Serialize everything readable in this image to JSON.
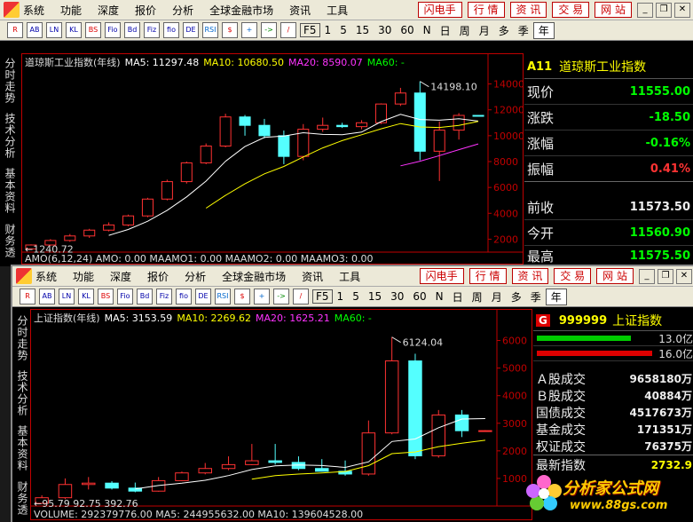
{
  "menu": {
    "items": [
      "系统",
      "功能",
      "深度",
      "报价",
      "分析",
      "全球金融市场",
      "资讯",
      "工具"
    ],
    "tabs": [
      "闪电手",
      "行  情",
      "资  讯",
      "交  易",
      "网  站"
    ]
  },
  "toolbar": {
    "icons": [
      "R",
      "AB",
      "LN",
      "KL",
      "BS",
      "Fio",
      "Bd",
      "Fiz",
      "fio",
      "DE",
      "RSI",
      "$",
      "+",
      "->",
      "/"
    ],
    "periods": [
      "F5",
      "1",
      "5",
      "15",
      "30",
      "60",
      "N",
      "日",
      "周",
      "月",
      "多",
      "季",
      "年"
    ]
  },
  "win1": {
    "side_tabs": [
      "分时走势",
      "技术分析",
      "基本资料",
      "财务透视"
    ],
    "legend": {
      "title": "道琼斯工业指数(年线)",
      "ma5": "MA5: 11297.48",
      "ma10": "MA10: 10680.50",
      "ma20": "MA20: 8590.07",
      "ma60": "MA60: -"
    },
    "high_label": "14198.10",
    "low_label": "1240.72",
    "y_ticks": [
      "14000",
      "12000",
      "10000",
      "8000",
      "6000",
      "4000",
      "2000"
    ],
    "footer": "AMO(6,12,24)  AMO: 0.00  MAAMO1: 0.00  MAAMO2: 0.00  MAAMO3: 0.00",
    "quote": {
      "code": "A11",
      "name": "道琼斯工业指数",
      "rows": [
        {
          "label": "现价",
          "value": "11555.00"
        },
        {
          "label": "涨跌",
          "value": "-18.50"
        },
        {
          "label": "涨幅",
          "value": "-0.16%"
        },
        {
          "label": "振幅",
          "value": "0.41%"
        },
        {
          "label": "前收",
          "value": "11573.50"
        },
        {
          "label": "今开",
          "value": "11560.90"
        },
        {
          "label": "最高",
          "value": "11575.50"
        }
      ]
    }
  },
  "win2": {
    "side_tabs": [
      "分时走势",
      "技术分析",
      "基本资料",
      "财务透视"
    ],
    "legend": {
      "title": "上证指数(年线)",
      "ma5": "MA5: 3153.59",
      "ma10": "MA10: 2269.62",
      "ma20": "MA20: 1625.21",
      "ma60": "MA60: -"
    },
    "high_label": "6124.04",
    "low_label": "95.79",
    "low_extra": "92.75 392.76",
    "y_ticks": [
      "6000",
      "5000",
      "4000",
      "3000",
      "2000",
      "1000"
    ],
    "footer": "VOLUME: 292379776.00  MA5: 244955632.00  MA10: 139604528.00",
    "quote": {
      "badge": "G",
      "code": "999999",
      "name": "上证指数",
      "bar_values": [
        "13.0亿",
        "16.0亿"
      ],
      "rows": [
        {
          "label": "Ａ股成交",
          "value": "9658180万"
        },
        {
          "label": "Ｂ股成交",
          "value": "40884万"
        },
        {
          "label": "国债成交",
          "value": "4517673万"
        },
        {
          "label": "基金成交",
          "value": "171351万"
        },
        {
          "label": "权证成交",
          "value": "76375万"
        },
        {
          "label": "最新指数",
          "value": "2732.9"
        }
      ]
    }
  },
  "watermark": {
    "line1": "分析家公式网",
    "line2": "www.88gs.com"
  },
  "colors": {
    "up": "#ff3232",
    "down": "#54ffff",
    "ma5": "#ffffff",
    "ma10": "#ffff00",
    "ma20": "#ff33ff",
    "axis": "#c00000"
  },
  "chart_data": [
    {
      "type": "candlestick",
      "title": "道琼斯工业指数(年线)",
      "x": [
        "1",
        "2",
        "3",
        "4",
        "5",
        "6",
        "7",
        "8",
        "9",
        "10",
        "11",
        "12",
        "13",
        "14",
        "15",
        "16",
        "17",
        "18",
        "19",
        "20",
        "21",
        "22",
        "23",
        "24"
      ],
      "open": [
        1250,
        1550,
        1900,
        2250,
        2700,
        3100,
        3800,
        5100,
        6450,
        7900,
        9200,
        11450,
        10800,
        10000,
        8400,
        10500,
        10800,
        10700,
        11000,
        12450,
        13300,
        8800,
        10430,
        11570
      ],
      "close": [
        1550,
        1900,
        2250,
        2700,
        3100,
        3800,
        5100,
        6450,
        7900,
        9200,
        11450,
        10800,
        10000,
        8400,
        10500,
        10800,
        10700,
        11000,
        12450,
        13300,
        8800,
        10430,
        11570,
        11555
      ],
      "high": [
        1600,
        2000,
        2400,
        2800,
        3300,
        3900,
        5200,
        6600,
        8000,
        9400,
        11700,
        11600,
        11300,
        10400,
        10900,
        11400,
        11000,
        11200,
        12500,
        13700,
        14198,
        11100,
        11750,
        11600
      ],
      "low": [
        1240,
        1500,
        1800,
        2100,
        2600,
        3000,
        3700,
        5000,
        6300,
        7800,
        9100,
        10000,
        9800,
        7800,
        8100,
        10300,
        10600,
        10500,
        10900,
        12300,
        8100,
        6500,
        9700,
        11500
      ],
      "ylim": [
        1000,
        15000
      ]
    },
    {
      "type": "candlestick",
      "title": "上证指数(年线)",
      "x": [
        "1",
        "2",
        "3",
        "4",
        "5",
        "6",
        "7",
        "8",
        "9",
        "10",
        "11",
        "12",
        "13",
        "14",
        "15",
        "16",
        "17",
        "18",
        "19",
        "20"
      ],
      "open": [
        96,
        300,
        780,
        830,
        650,
        540,
        920,
        1200,
        1360,
        1500,
        1640,
        1580,
        1360,
        1260,
        1160,
        2650,
        5260,
        1820,
        3300,
        2730
      ],
      "close": [
        300,
        780,
        830,
        650,
        540,
        920,
        1200,
        1360,
        1500,
        1640,
        1580,
        1360,
        1260,
        1160,
        2650,
        5260,
        1820,
        3300,
        2730,
        2732
      ],
      "high": [
        390,
        1000,
        1050,
        900,
        850,
        1050,
        1250,
        1560,
        1800,
        2250,
        2250,
        1800,
        1700,
        1650,
        3100,
        6124,
        5520,
        3480,
        3480,
        2750
      ],
      "low": [
        90,
        250,
        600,
        600,
        500,
        520,
        900,
        1150,
        1300,
        1480,
        1500,
        1300,
        1250,
        1100,
        1100,
        2600,
        1700,
        1750,
        2500,
        2700
      ],
      "ylim": [
        0,
        6500
      ]
    }
  ]
}
